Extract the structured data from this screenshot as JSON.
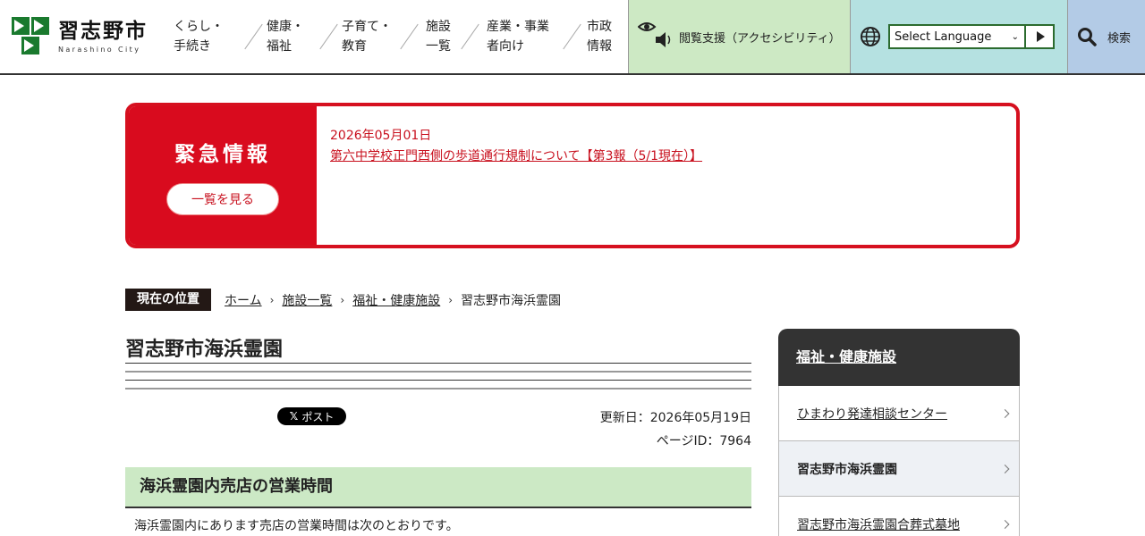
{
  "header": {
    "logo": {
      "name": "習志野市",
      "sub": "Narashino City"
    },
    "nav": [
      {
        "line1": "くらし・",
        "line2": "手続き"
      },
      {
        "line1": "健康・",
        "line2": "福祉"
      },
      {
        "line1": "子育て・",
        "line2": "教育"
      },
      {
        "line1": "施設",
        "line2": "一覧"
      },
      {
        "line1": "産業・事業",
        "line2": "者向け"
      },
      {
        "line1": "市政",
        "line2": "情報"
      }
    ],
    "accessibility_label": "閲覧支援（アクセシビリティ）",
    "language_select": "Select Language",
    "search_label": "検索"
  },
  "emergency": {
    "title": "緊急情報",
    "list_button": "一覧を見る",
    "date": "2026年05月01日",
    "link": "第六中学校正門西側の歩道通行規制について【第3報（5/1現在）】"
  },
  "breadcrumb": {
    "label": "現在の位置",
    "items": [
      "ホーム",
      "施設一覧",
      "福祉・健康施設"
    ],
    "current": "習志野市海浜霊園"
  },
  "page": {
    "title": "習志野市海浜霊園",
    "x_post": "ポスト",
    "updated": "更新日：2026年05月19日",
    "page_id": "ページID：7964",
    "section_heading": "海浜霊園内売店の営業時間",
    "body": "海浜霊園内にあります売店の営業時間は次のとおりです。"
  },
  "sidebar": {
    "heading": "福祉・健康施設",
    "items": [
      {
        "label": "ひまわり発達相談センター"
      },
      {
        "label": "習志野市海浜霊園"
      },
      {
        "label": "習志野市海浜霊園合葬式墓地"
      }
    ]
  },
  "colors": {
    "emergency_red": "#d90b1e",
    "access_bg": "#cde9c4",
    "lang_bg": "#b5e1e1",
    "search_bg": "#b3cbe6",
    "logo_green": "#1a7a2e"
  }
}
